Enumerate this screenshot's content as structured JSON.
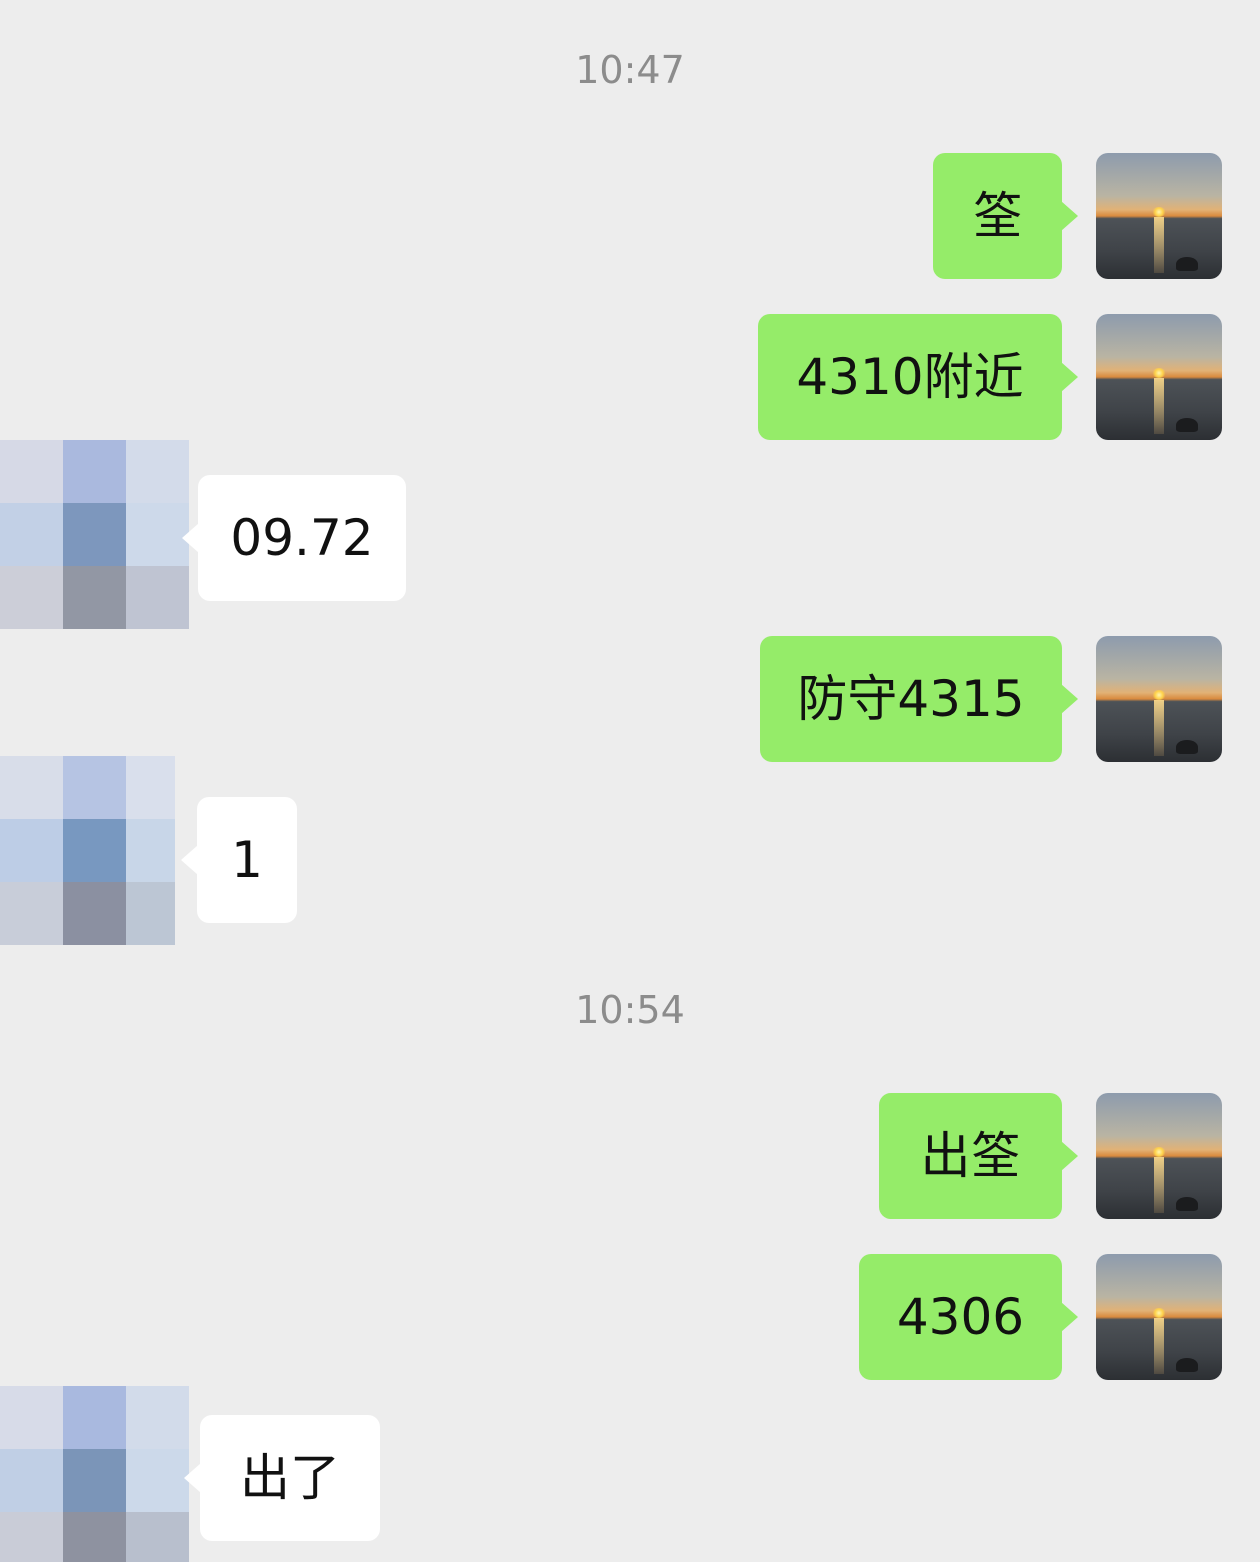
{
  "timestamps": [
    "10:47",
    "10:54"
  ],
  "messages": [
    {
      "sender": "me",
      "text": "筌"
    },
    {
      "sender": "me",
      "text": "4310附近"
    },
    {
      "sender": "other",
      "text": "09.72"
    },
    {
      "sender": "me",
      "text": "防守4315"
    },
    {
      "sender": "other",
      "text": "1"
    },
    {
      "sender": "me",
      "text": "出筌"
    },
    {
      "sender": "me",
      "text": "4306"
    },
    {
      "sender": "other",
      "text": "出了"
    }
  ],
  "colors": {
    "background": "#ededed",
    "my_bubble": "#95ec69",
    "other_bubble": "#ffffff",
    "timestamp_text": "#8c8c8c"
  },
  "icons": {
    "my_avatar": "sunset-avatar-icon",
    "other_avatar": "pixelated-avatar-icon"
  }
}
